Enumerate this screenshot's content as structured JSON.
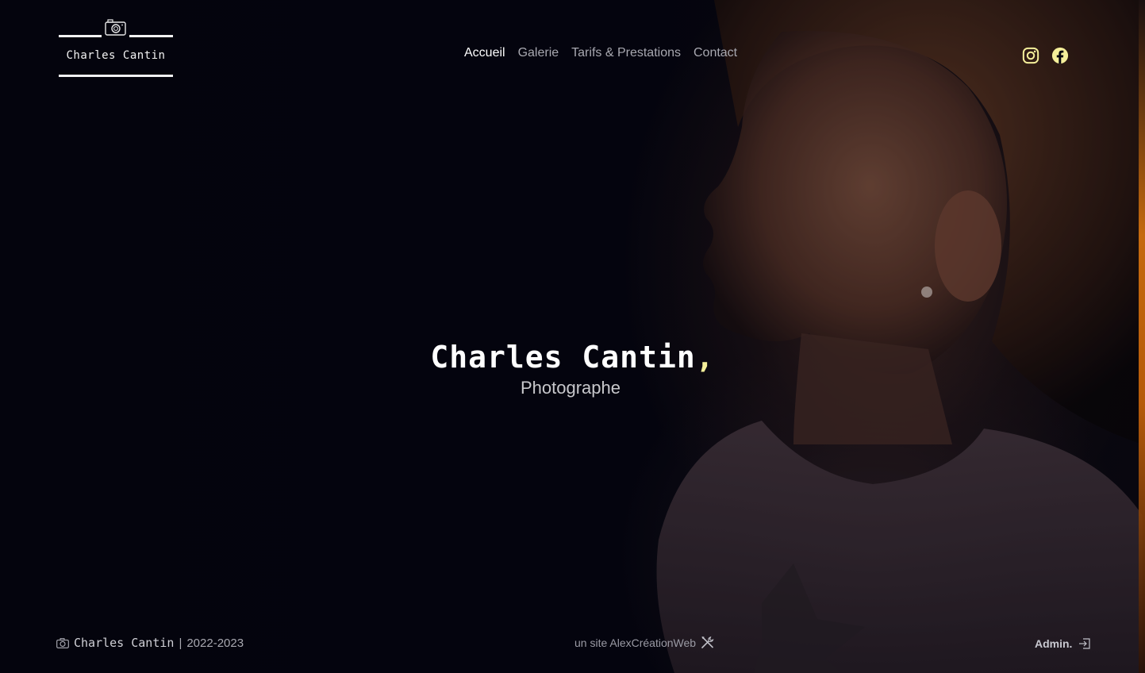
{
  "brand": {
    "name": "Charles Cantin",
    "logo_icon": "camera-icon"
  },
  "nav": {
    "items": [
      {
        "label": "Accueil",
        "active": true
      },
      {
        "label": "Galerie",
        "active": false
      },
      {
        "label": "Tarifs & Prestations",
        "active": false
      },
      {
        "label": "Contact",
        "active": false
      }
    ]
  },
  "social": {
    "instagram_icon": "instagram-icon",
    "facebook_icon": "facebook-icon",
    "color": "#f5ef9a"
  },
  "hero": {
    "title": "Charles Cantin",
    "comma": ",",
    "subtitle": "Photographe",
    "background": "portrait of a young girl looking up"
  },
  "footer": {
    "left_name": "Charles Cantin",
    "left_sep": "|",
    "left_years": "2022-2023",
    "center_text": "un site AlexCréationWeb",
    "center_icon": "tools-icon",
    "right_label": "Admin.",
    "right_icon": "login-icon"
  },
  "colors": {
    "accent": "#f5ef9a",
    "background": "#05050f",
    "nav_inactive": "#a8a8b0"
  }
}
